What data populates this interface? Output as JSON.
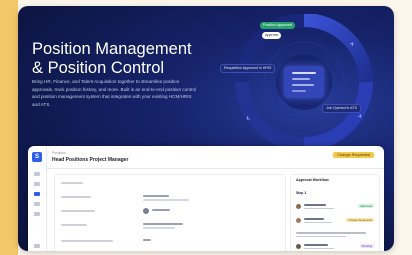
{
  "hero": {
    "title_line1": "Position Management",
    "title_line2": "& Position Control",
    "description": "Bring HR, Finance, and Talent Acquisition together to streamline position approvals, track position history, and more. Built is an end-to-end position control and position management system that integrates with your existing HCM/HRIS and ATS."
  },
  "diagram": {
    "badge_top": "Position Approved",
    "pill_top": "Approve",
    "chip_left": "Requisition Approved in HRIS",
    "chip_bottom": "Job Opened in ATS"
  },
  "app": {
    "logo": "S",
    "breadcrumb": "Positions",
    "title": "Head Positions Project Manager",
    "status": "Change Requested",
    "side_panel_title": "Approval Workflow",
    "side_panel_section": "Step 1",
    "tags": {
      "approved": "Approved",
      "change_requested": "Change Requested",
      "pending": "Pending"
    }
  },
  "colors": {
    "hero_bg": "#101a55",
    "accent": "#2e5fe8",
    "status_badge": "#f3c94a",
    "approved": "#27a06a"
  }
}
